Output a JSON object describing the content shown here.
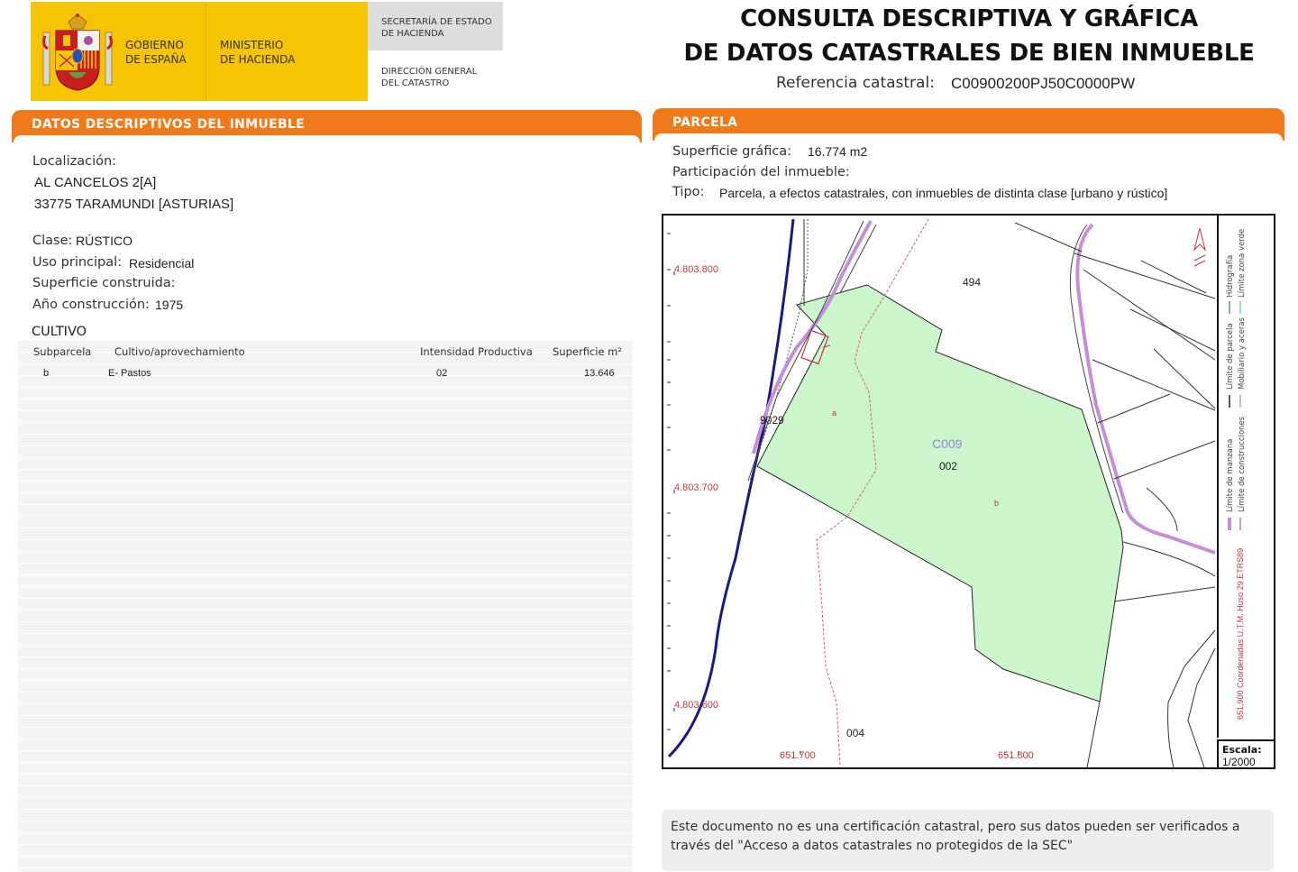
{
  "header": {
    "gov_line1": "GOBIERNO",
    "gov_line2": "DE ESPAÑA",
    "min_line1": "MINISTERIO",
    "min_line2": "DE HACIENDA",
    "sec_line1": "SECRETARÍA DE ESTADO",
    "sec_line2": "DE HACIENDA",
    "dir_line1": "DIRECCIÓN GENERAL",
    "dir_line2": "DEL CATASTRO",
    "title_line1": "CONSULTA DESCRIPTIVA Y GRÁFICA",
    "title_line2": "DE DATOS CATASTRALES DE BIEN INMUEBLE",
    "ref_label": "Referencia catastral:",
    "ref_value": "C00900200PJ50C0000PW"
  },
  "descriptivos": {
    "section_title": "DATOS DESCRIPTIVOS DEL INMUEBLE",
    "localizacion_label": "Localización:",
    "address_line1": "AL CANCELOS 2[A]",
    "address_line2": "33775 TARAMUNDI [ASTURIAS]",
    "clase_label": "Clase:",
    "clase_value": "RÚSTICO",
    "uso_label": "Uso principal:",
    "uso_value": "Residencial",
    "superficie_label": "Superficie construida:",
    "anio_label": "Año construcción:",
    "anio_value": "1975"
  },
  "cultivo": {
    "title": "CULTIVO",
    "headers": [
      "Subparcela",
      "Cultivo/aprovechamiento",
      "Intensidad Productiva",
      "Superficie m²"
    ],
    "rows": [
      {
        "subparcela": "b",
        "cultivo": "E- Pastos",
        "intensidad": "02",
        "superficie": "13.646"
      }
    ]
  },
  "parcela": {
    "section_title": "PARCELA",
    "superficie_label": "Superficie gráfica:",
    "superficie_value": "16.774 m2",
    "participacion_label": "Participación del inmueble:",
    "tipo_label": "Tipo:",
    "tipo_value": "Parcela, a efectos catastrales, con inmuebles de distinta clase [urbano y rústico]"
  },
  "map": {
    "y_coords": [
      "4.803.800",
      "4.803.700",
      "4.803.600"
    ],
    "x_coords": [
      "651.700",
      "651.800"
    ],
    "parcel_labels": {
      "p494": "494",
      "p9029": "9029",
      "c009": "C009",
      "p002": "002",
      "p004": "004",
      "sub_a": "a",
      "sub_b": "b"
    },
    "legend_col1": [
      "Hidrografía",
      "Límite de parcela",
      "Límite de manzana"
    ],
    "legend_col2": [
      "Límite zona verde",
      "Mobiliario y aceras",
      "Límite de construcciones"
    ],
    "coord_system": "651,900 Coordenadas U.T.M. Huso 29 ETRS89",
    "scale_label": "Escala:",
    "scale_value": "1/2000",
    "colors": {
      "parcel_fill": "#ccf5cc",
      "road": "#c58fd8",
      "river": "#1a1a80",
      "coord": "#c03a3a"
    }
  },
  "disclaimer": {
    "line1": "Este documento no es una certificación catastral, pero sus datos pueden ser verificados a",
    "line2": "través del \"Acceso a datos catastrales no protegidos de la SEC\""
  }
}
